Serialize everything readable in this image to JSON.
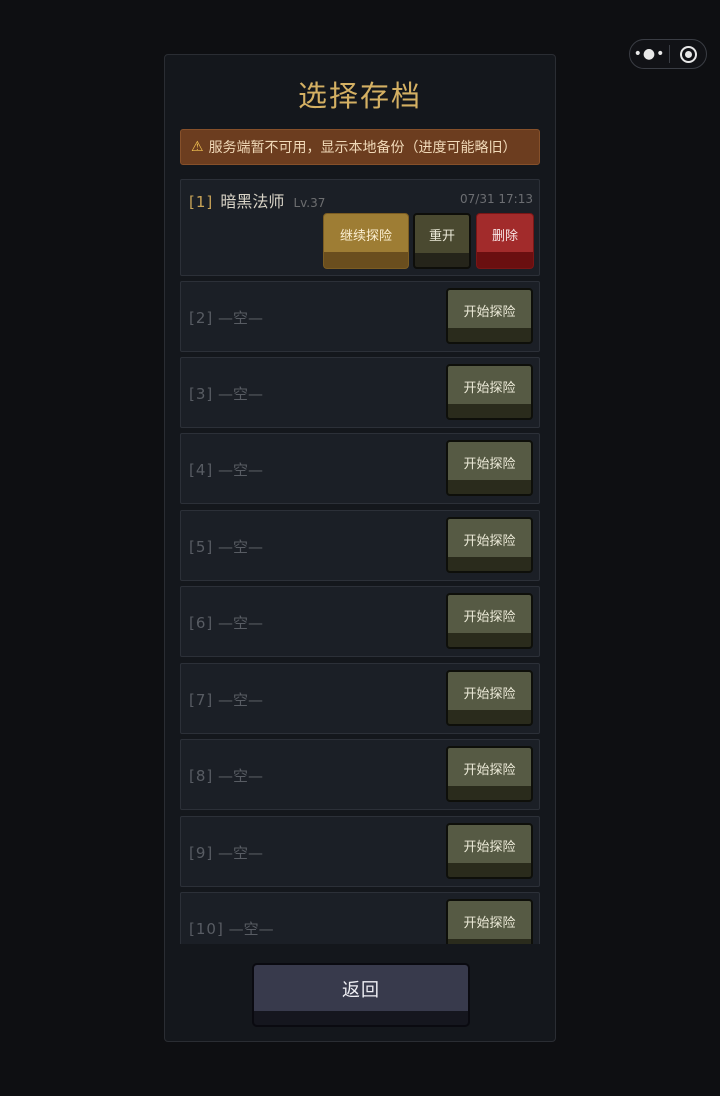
{
  "capsule": {
    "menu_icon": "more-dots-icon",
    "close_icon": "target-circle-icon",
    "menu_glyph": "•●•"
  },
  "title": "选择存档",
  "warning": {
    "icon": "⚠",
    "text": "服务端暂不可用，显示本地备份（进度可能略旧）"
  },
  "filled_slot": {
    "number": "[1]",
    "name": "暗黑法师",
    "level": "Lv.37",
    "date": "07/31 17:13",
    "continue_label": "继续探险",
    "restart_label": "重开",
    "delete_label": "删除"
  },
  "empty_slots": [
    {
      "number": "[2]",
      "label": "—空—",
      "button": "开始探险"
    },
    {
      "number": "[3]",
      "label": "—空—",
      "button": "开始探险"
    },
    {
      "number": "[4]",
      "label": "—空—",
      "button": "开始探险"
    },
    {
      "number": "[5]",
      "label": "—空—",
      "button": "开始探险"
    },
    {
      "number": "[6]",
      "label": "—空—",
      "button": "开始探险"
    },
    {
      "number": "[7]",
      "label": "—空—",
      "button": "开始探险"
    },
    {
      "number": "[8]",
      "label": "—空—",
      "button": "开始探险"
    },
    {
      "number": "[9]",
      "label": "—空—",
      "button": "开始探险"
    },
    {
      "number": "[10]",
      "label": "—空—",
      "button": "开始探险"
    }
  ],
  "back_label": "返回",
  "colors": {
    "accent": "#d4b063",
    "warning_bg": "#6c3d1f",
    "delete": "#a22b2b",
    "continue": "#9e7d34"
  }
}
